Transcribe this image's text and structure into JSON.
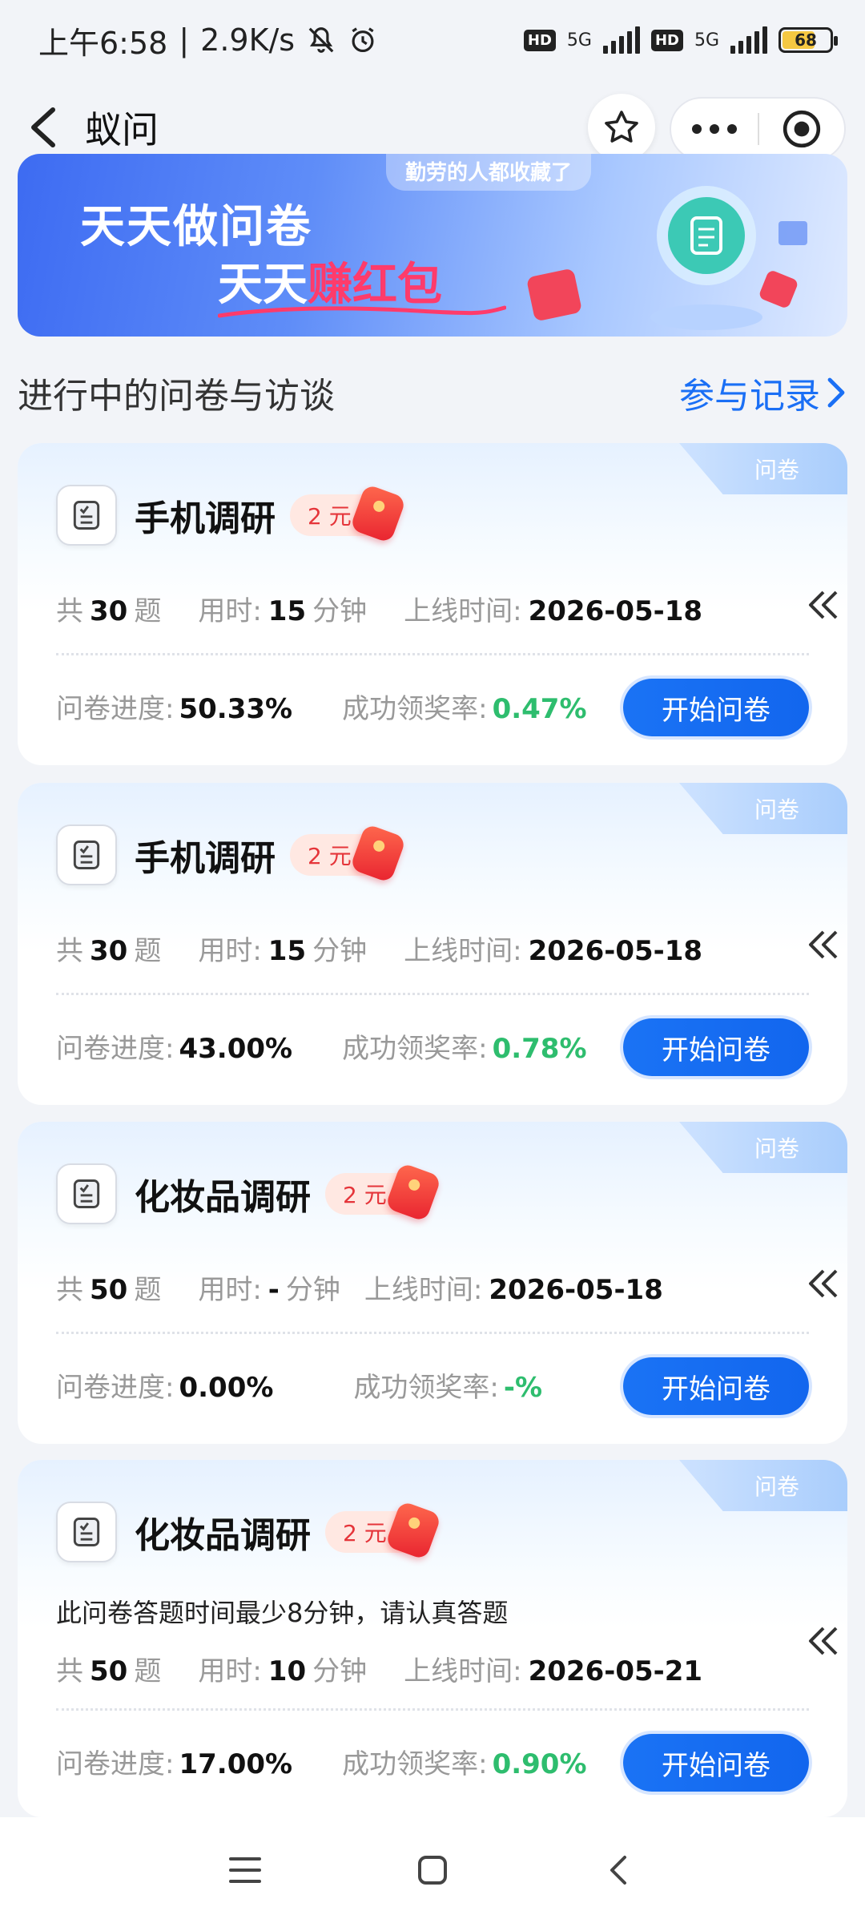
{
  "status": {
    "time": "上午6:58",
    "speed": "2.9K/s",
    "hd": "HD",
    "net": "5G",
    "battery": "68"
  },
  "nav": {
    "title": "蚁问"
  },
  "banner": {
    "pill": "勤劳的人都收藏了",
    "line1": "天天做问卷",
    "line2_prefix": "天天",
    "line2_highlight": "赚红包"
  },
  "section": {
    "title": "进行中的问卷与访谈",
    "records_link": "参与记录"
  },
  "labels": {
    "type": "问卷",
    "total_prefix": "共",
    "total_suffix": "题",
    "time_prefix": "用时:",
    "time_suffix": "分钟",
    "online_prefix": "上线时间:",
    "progress_prefix": "问卷进度:",
    "rate_prefix": "成功领奖率:",
    "start_button": "开始问卷"
  },
  "surveys": [
    {
      "title": "手机调研",
      "reward": "2 元",
      "questions": "30",
      "minutes": "15",
      "online": "2026-05-18",
      "progress": "50.33%",
      "rate": "0.47%"
    },
    {
      "title": "手机调研",
      "reward": "2 元",
      "questions": "30",
      "minutes": "15",
      "online": "2026-05-18",
      "progress": "43.00%",
      "rate": "0.78%"
    },
    {
      "title": "化妆品调研",
      "reward": "2 元",
      "questions": "50",
      "minutes": "-",
      "online": "2026-05-18",
      "progress": "0.00%",
      "rate": "-%"
    },
    {
      "title": "化妆品调研",
      "reward": "2 元",
      "note": "此问卷答题时间最少8分钟，请认真答题",
      "questions": "50",
      "minutes": "10",
      "online": "2026-05-21",
      "progress": "17.00%",
      "rate": "0.90%"
    }
  ],
  "colors": {
    "primary": "#1a73f5",
    "success": "#2ebd6e",
    "reward": "#e5353a"
  }
}
